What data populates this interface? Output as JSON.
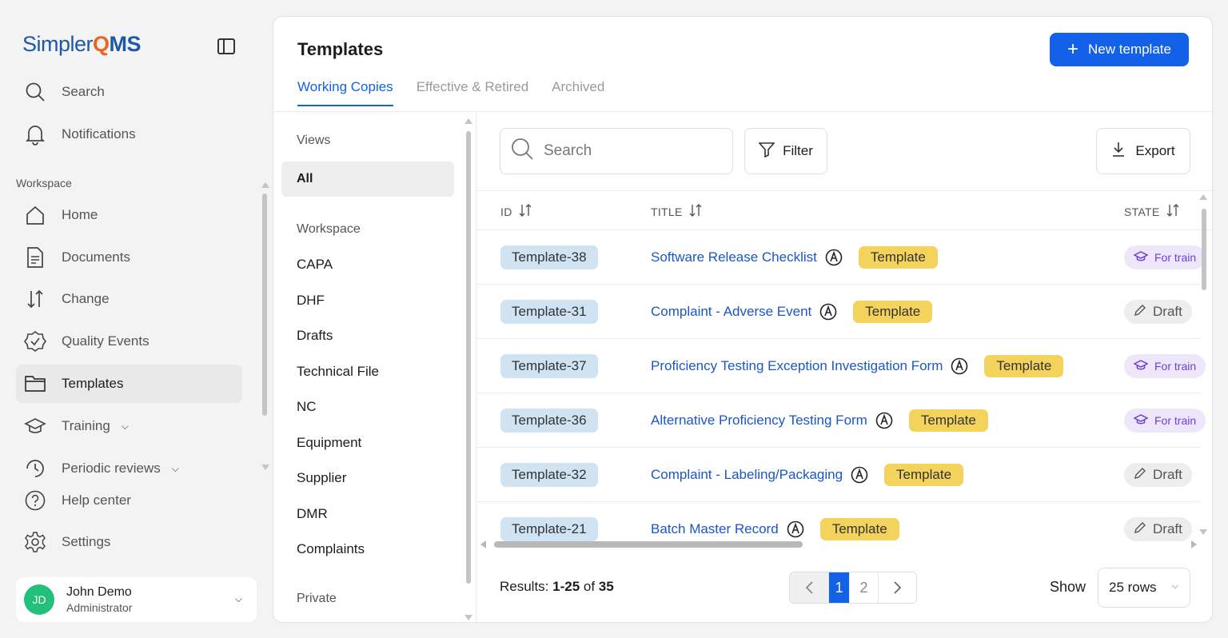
{
  "brand": {
    "name_part1": "Simpler",
    "name_q": "Q",
    "name_part2": "MS"
  },
  "sidebar": {
    "top_items": [
      {
        "label": "Search",
        "icon": "search-icon"
      },
      {
        "label": "Notifications",
        "icon": "bell-icon"
      }
    ],
    "workspace_label": "Workspace",
    "items": [
      {
        "label": "Home",
        "icon": "home-icon"
      },
      {
        "label": "Documents",
        "icon": "document-icon"
      },
      {
        "label": "Change",
        "icon": "sort-arrows-icon"
      },
      {
        "label": "Quality Events",
        "icon": "shield-check-icon"
      },
      {
        "label": "Templates",
        "icon": "folder-icon",
        "active": true
      },
      {
        "label": "Training",
        "icon": "graduation-cap-icon",
        "has_chevron": true
      },
      {
        "label": "Periodic reviews",
        "icon": "clock-history-icon",
        "has_chevron": true
      },
      {
        "label": "Help center",
        "icon": "help-circle-icon"
      },
      {
        "label": "Settings",
        "icon": "gear-icon"
      }
    ],
    "user": {
      "initials": "JD",
      "name": "John Demo",
      "role": "Administrator"
    }
  },
  "header": {
    "title": "Templates",
    "new_button_label": "New template",
    "tabs": [
      {
        "label": "Working Copies",
        "active": true
      },
      {
        "label": "Effective & Retired"
      },
      {
        "label": "Archived"
      }
    ]
  },
  "views": {
    "views_label": "Views",
    "all_label": "All",
    "workspace_label": "Workspace",
    "workspace_items": [
      "CAPA",
      "DHF",
      "Drafts",
      "Technical File",
      "NC",
      "Equipment",
      "Supplier",
      "DMR",
      "Complaints"
    ],
    "private_label": "Private"
  },
  "toolbar": {
    "search_placeholder": "Search",
    "filter_label": "Filter",
    "export_label": "Export"
  },
  "table": {
    "columns": [
      "ID",
      "TITLE",
      "STATE"
    ],
    "rows": [
      {
        "id": "Template-38",
        "title": "Software Release Checklist",
        "badge": "Template",
        "state": "For train",
        "state_type": "train"
      },
      {
        "id": "Template-31",
        "title": "Complaint - Adverse Event",
        "badge": "Template",
        "state": "Draft",
        "state_type": "draft"
      },
      {
        "id": "Template-37",
        "title": "Proficiency Testing Exception Investigation Form",
        "badge": "Template",
        "state": "For train",
        "state_type": "train"
      },
      {
        "id": "Template-36",
        "title": "Alternative Proficiency Testing Form",
        "badge": "Template",
        "state": "For train",
        "state_type": "train"
      },
      {
        "id": "Template-32",
        "title": "Complaint - Labeling/Packaging",
        "badge": "Template",
        "state": "Draft",
        "state_type": "draft"
      },
      {
        "id": "Template-21",
        "title": "Batch Master Record",
        "badge": "Template",
        "state": "Draft",
        "state_type": "draft"
      }
    ]
  },
  "footer": {
    "results_prefix": "Results: ",
    "results_range": "1-25",
    "results_of": " of ",
    "results_total": "35",
    "pages": [
      "1",
      "2"
    ],
    "current_page": "1",
    "show_label": "Show",
    "rows_option": "25 rows"
  },
  "colors": {
    "accent": "#1261e8",
    "id_pill": "#cfe3f3",
    "template_badge": "#f3d35b",
    "train_state": "#eee7fb",
    "avatar": "#22c07a"
  }
}
